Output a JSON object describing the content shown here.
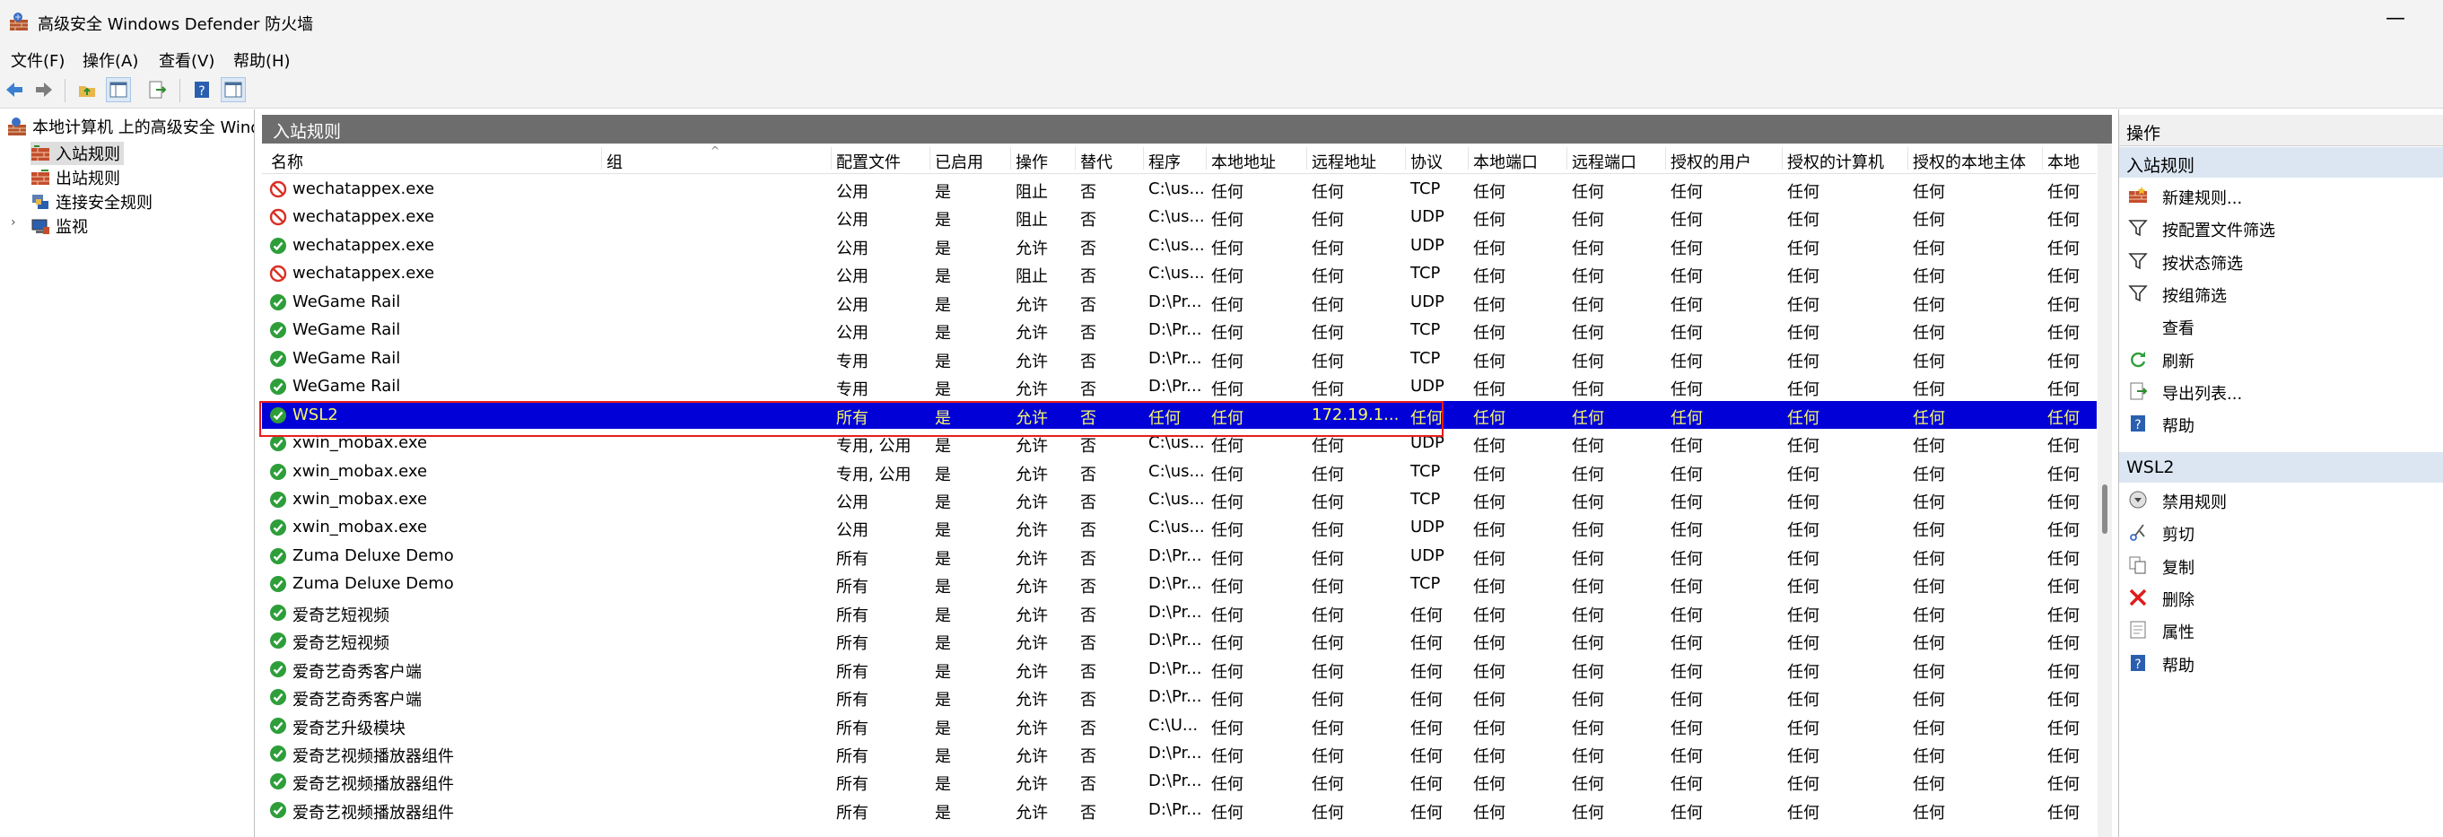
{
  "window": {
    "title": "高级安全 Windows Defender 防火墙",
    "minimize_glyph": "—"
  },
  "menu": [
    "文件(F)",
    "操作(A)",
    "查看(V)",
    "帮助(H)"
  ],
  "tree": {
    "root": "本地计算机 上的高级安全 Windows Defender 防火墙",
    "items": [
      "入站规则",
      "出站规则",
      "连接安全规则",
      "监视"
    ],
    "expander": "›"
  },
  "middle": {
    "header": "入站规则",
    "columns": [
      "名称",
      "组",
      "配置文件",
      "已启用",
      "操作",
      "替代",
      "程序",
      "本地地址",
      "远程地址",
      "协议",
      "本地端口",
      "远程端口",
      "授权的用户",
      "授权的计算机",
      "授权的本地主体",
      "本地"
    ],
    "rows": [
      {
        "icon": "block",
        "name": "wechatappex.exe",
        "profile": "公用",
        "enabled": "是",
        "action": "阻止",
        "override": "否",
        "program": "C:\\us...",
        "local_addr": "任何",
        "remote_addr": "任何",
        "protocol": "TCP",
        "local_port": "任何",
        "remote_port": "任何",
        "auth_users": "任何",
        "auth_computers": "任何",
        "auth_local": "任何",
        "last": "任何"
      },
      {
        "icon": "block",
        "name": "wechatappex.exe",
        "profile": "公用",
        "enabled": "是",
        "action": "阻止",
        "override": "否",
        "program": "C:\\us...",
        "local_addr": "任何",
        "remote_addr": "任何",
        "protocol": "UDP",
        "local_port": "任何",
        "remote_port": "任何",
        "auth_users": "任何",
        "auth_computers": "任何",
        "auth_local": "任何",
        "last": "任何"
      },
      {
        "icon": "allow",
        "name": "wechatappex.exe",
        "profile": "公用",
        "enabled": "是",
        "action": "允许",
        "override": "否",
        "program": "C:\\us...",
        "local_addr": "任何",
        "remote_addr": "任何",
        "protocol": "UDP",
        "local_port": "任何",
        "remote_port": "任何",
        "auth_users": "任何",
        "auth_computers": "任何",
        "auth_local": "任何",
        "last": "任何"
      },
      {
        "icon": "block",
        "name": "wechatappex.exe",
        "profile": "公用",
        "enabled": "是",
        "action": "阻止",
        "override": "否",
        "program": "C:\\us...",
        "local_addr": "任何",
        "remote_addr": "任何",
        "protocol": "TCP",
        "local_port": "任何",
        "remote_port": "任何",
        "auth_users": "任何",
        "auth_computers": "任何",
        "auth_local": "任何",
        "last": "任何"
      },
      {
        "icon": "allow",
        "name": "WeGame Rail",
        "profile": "公用",
        "enabled": "是",
        "action": "允许",
        "override": "否",
        "program": "D:\\Pr...",
        "local_addr": "任何",
        "remote_addr": "任何",
        "protocol": "UDP",
        "local_port": "任何",
        "remote_port": "任何",
        "auth_users": "任何",
        "auth_computers": "任何",
        "auth_local": "任何",
        "last": "任何"
      },
      {
        "icon": "allow",
        "name": "WeGame Rail",
        "profile": "公用",
        "enabled": "是",
        "action": "允许",
        "override": "否",
        "program": "D:\\Pr...",
        "local_addr": "任何",
        "remote_addr": "任何",
        "protocol": "TCP",
        "local_port": "任何",
        "remote_port": "任何",
        "auth_users": "任何",
        "auth_computers": "任何",
        "auth_local": "任何",
        "last": "任何"
      },
      {
        "icon": "allow",
        "name": "WeGame Rail",
        "profile": "专用",
        "enabled": "是",
        "action": "允许",
        "override": "否",
        "program": "D:\\Pr...",
        "local_addr": "任何",
        "remote_addr": "任何",
        "protocol": "TCP",
        "local_port": "任何",
        "remote_port": "任何",
        "auth_users": "任何",
        "auth_computers": "任何",
        "auth_local": "任何",
        "last": "任何"
      },
      {
        "icon": "allow",
        "name": "WeGame Rail",
        "profile": "专用",
        "enabled": "是",
        "action": "允许",
        "override": "否",
        "program": "D:\\Pr...",
        "local_addr": "任何",
        "remote_addr": "任何",
        "protocol": "UDP",
        "local_port": "任何",
        "remote_port": "任何",
        "auth_users": "任何",
        "auth_computers": "任何",
        "auth_local": "任何",
        "last": "任何"
      },
      {
        "icon": "allow",
        "name": "WSL2",
        "profile": "所有",
        "enabled": "是",
        "action": "允许",
        "override": "否",
        "program": "任何",
        "local_addr": "任何",
        "remote_addr": "172.19.1...",
        "protocol": "任何",
        "local_port": "任何",
        "remote_port": "任何",
        "auth_users": "任何",
        "auth_computers": "任何",
        "auth_local": "任何",
        "last": "任何",
        "selected": true
      },
      {
        "icon": "allow",
        "name": "xwin_mobax.exe",
        "profile": "专用, 公用",
        "enabled": "是",
        "action": "允许",
        "override": "否",
        "program": "C:\\us...",
        "local_addr": "任何",
        "remote_addr": "任何",
        "protocol": "UDP",
        "local_port": "任何",
        "remote_port": "任何",
        "auth_users": "任何",
        "auth_computers": "任何",
        "auth_local": "任何",
        "last": "任何"
      },
      {
        "icon": "allow",
        "name": "xwin_mobax.exe",
        "profile": "专用, 公用",
        "enabled": "是",
        "action": "允许",
        "override": "否",
        "program": "C:\\us...",
        "local_addr": "任何",
        "remote_addr": "任何",
        "protocol": "TCP",
        "local_port": "任何",
        "remote_port": "任何",
        "auth_users": "任何",
        "auth_computers": "任何",
        "auth_local": "任何",
        "last": "任何"
      },
      {
        "icon": "allow",
        "name": "xwin_mobax.exe",
        "profile": "公用",
        "enabled": "是",
        "action": "允许",
        "override": "否",
        "program": "C:\\us...",
        "local_addr": "任何",
        "remote_addr": "任何",
        "protocol": "TCP",
        "local_port": "任何",
        "remote_port": "任何",
        "auth_users": "任何",
        "auth_computers": "任何",
        "auth_local": "任何",
        "last": "任何"
      },
      {
        "icon": "allow",
        "name": "xwin_mobax.exe",
        "profile": "公用",
        "enabled": "是",
        "action": "允许",
        "override": "否",
        "program": "C:\\us...",
        "local_addr": "任何",
        "remote_addr": "任何",
        "protocol": "UDP",
        "local_port": "任何",
        "remote_port": "任何",
        "auth_users": "任何",
        "auth_computers": "任何",
        "auth_local": "任何",
        "last": "任何"
      },
      {
        "icon": "allow",
        "name": "Zuma Deluxe Demo",
        "profile": "所有",
        "enabled": "是",
        "action": "允许",
        "override": "否",
        "program": "D:\\Pr...",
        "local_addr": "任何",
        "remote_addr": "任何",
        "protocol": "UDP",
        "local_port": "任何",
        "remote_port": "任何",
        "auth_users": "任何",
        "auth_computers": "任何",
        "auth_local": "任何",
        "last": "任何"
      },
      {
        "icon": "allow",
        "name": "Zuma Deluxe Demo",
        "profile": "所有",
        "enabled": "是",
        "action": "允许",
        "override": "否",
        "program": "D:\\Pr...",
        "local_addr": "任何",
        "remote_addr": "任何",
        "protocol": "TCP",
        "local_port": "任何",
        "remote_port": "任何",
        "auth_users": "任何",
        "auth_computers": "任何",
        "auth_local": "任何",
        "last": "任何"
      },
      {
        "icon": "allow",
        "name": "爱奇艺短视频",
        "profile": "所有",
        "enabled": "是",
        "action": "允许",
        "override": "否",
        "program": "D:\\Pr...",
        "local_addr": "任何",
        "remote_addr": "任何",
        "protocol": "任何",
        "local_port": "任何",
        "remote_port": "任何",
        "auth_users": "任何",
        "auth_computers": "任何",
        "auth_local": "任何",
        "last": "任何"
      },
      {
        "icon": "allow",
        "name": "爱奇艺短视频",
        "profile": "所有",
        "enabled": "是",
        "action": "允许",
        "override": "否",
        "program": "D:\\Pr...",
        "local_addr": "任何",
        "remote_addr": "任何",
        "protocol": "任何",
        "local_port": "任何",
        "remote_port": "任何",
        "auth_users": "任何",
        "auth_computers": "任何",
        "auth_local": "任何",
        "last": "任何"
      },
      {
        "icon": "allow",
        "name": "爱奇艺奇秀客户端",
        "profile": "所有",
        "enabled": "是",
        "action": "允许",
        "override": "否",
        "program": "D:\\Pr...",
        "local_addr": "任何",
        "remote_addr": "任何",
        "protocol": "任何",
        "local_port": "任何",
        "remote_port": "任何",
        "auth_users": "任何",
        "auth_computers": "任何",
        "auth_local": "任何",
        "last": "任何"
      },
      {
        "icon": "allow",
        "name": "爱奇艺奇秀客户端",
        "profile": "所有",
        "enabled": "是",
        "action": "允许",
        "override": "否",
        "program": "D:\\Pr...",
        "local_addr": "任何",
        "remote_addr": "任何",
        "protocol": "任何",
        "local_port": "任何",
        "remote_port": "任何",
        "auth_users": "任何",
        "auth_computers": "任何",
        "auth_local": "任何",
        "last": "任何"
      },
      {
        "icon": "allow",
        "name": "爱奇艺升级模块",
        "profile": "所有",
        "enabled": "是",
        "action": "允许",
        "override": "否",
        "program": "C:\\U...",
        "local_addr": "任何",
        "remote_addr": "任何",
        "protocol": "任何",
        "local_port": "任何",
        "remote_port": "任何",
        "auth_users": "任何",
        "auth_computers": "任何",
        "auth_local": "任何",
        "last": "任何"
      },
      {
        "icon": "allow",
        "name": "爱奇艺视频播放器组件",
        "profile": "所有",
        "enabled": "是",
        "action": "允许",
        "override": "否",
        "program": "D:\\Pr...",
        "local_addr": "任何",
        "remote_addr": "任何",
        "protocol": "任何",
        "local_port": "任何",
        "remote_port": "任何",
        "auth_users": "任何",
        "auth_computers": "任何",
        "auth_local": "任何",
        "last": "任何"
      },
      {
        "icon": "allow",
        "name": "爱奇艺视频播放器组件",
        "profile": "所有",
        "enabled": "是",
        "action": "允许",
        "override": "否",
        "program": "D:\\Pr...",
        "local_addr": "任何",
        "remote_addr": "任何",
        "protocol": "任何",
        "local_port": "任何",
        "remote_port": "任何",
        "auth_users": "任何",
        "auth_computers": "任何",
        "auth_local": "任何",
        "last": "任何"
      },
      {
        "icon": "allow",
        "name": "爱奇艺视频播放器组件",
        "profile": "所有",
        "enabled": "是",
        "action": "允许",
        "override": "否",
        "program": "D:\\Pr...",
        "local_addr": "任何",
        "remote_addr": "任何",
        "protocol": "任何",
        "local_port": "任何",
        "remote_port": "任何",
        "auth_users": "任何",
        "auth_computers": "任何",
        "auth_local": "任何",
        "last": "任何"
      }
    ]
  },
  "actions": {
    "header": "操作",
    "section1": {
      "title": "入站规则",
      "items": [
        {
          "icon": "new-rule",
          "label": "新建规则..."
        },
        {
          "icon": "filter",
          "label": "按配置文件筛选"
        },
        {
          "icon": "filter",
          "label": "按状态筛选"
        },
        {
          "icon": "filter",
          "label": "按组筛选"
        },
        {
          "icon": "none",
          "label": "查看"
        },
        {
          "icon": "refresh",
          "label": "刷新"
        },
        {
          "icon": "export",
          "label": "导出列表..."
        },
        {
          "icon": "help",
          "label": "帮助"
        }
      ]
    },
    "section2": {
      "title": "WSL2",
      "items": [
        {
          "icon": "disable",
          "label": "禁用规则"
        },
        {
          "icon": "cut",
          "label": "剪切"
        },
        {
          "icon": "copy",
          "label": "复制"
        },
        {
          "icon": "delete",
          "label": "删除"
        },
        {
          "icon": "properties",
          "label": "属性"
        },
        {
          "icon": "help",
          "label": "帮助"
        }
      ]
    }
  },
  "colors": {
    "selected_row_bg": "#0000d7",
    "selected_row_text": "#f7f76a",
    "highlight_box": "#e81d1d",
    "allow_green": "#2e9e3a",
    "block_red": "#d93025"
  }
}
